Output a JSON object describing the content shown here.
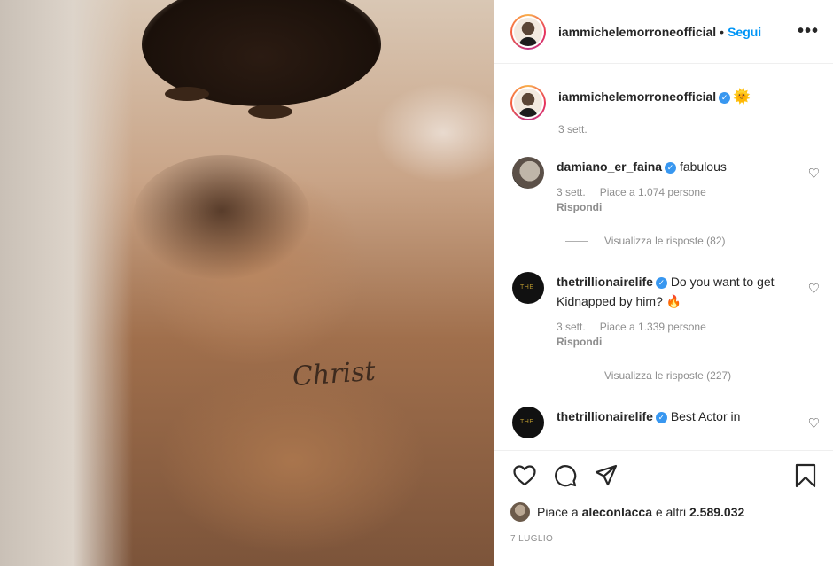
{
  "post_image": {
    "tattoo_text": "Christ",
    "alt": ""
  },
  "header": {
    "username": "iammichelemorroneofficial",
    "separator": "•",
    "follow_label": "Segui",
    "more_label": "•••"
  },
  "caption": {
    "username": "iammichelemorroneofficial",
    "emoji": "🌞",
    "time": "3 sett."
  },
  "comments": [
    {
      "username": "damiano_er_faina",
      "text": "fabulous",
      "time": "3 sett.",
      "likes": "Piace a 1.074 persone",
      "reply": "Rispondi",
      "view_replies": "Visualizza le risposte (82)"
    },
    {
      "username": "thetrillionairelife",
      "text": "Do you want to get Kidnapped by him? 🔥",
      "time": "3 sett.",
      "likes": "Piace a 1.339 persone",
      "reply": "Rispondi",
      "view_replies": "Visualizza le risposte (227)"
    },
    {
      "username": "thetrillionairelife",
      "text": "Best Actor in"
    }
  ],
  "likes_line": {
    "prefix": "Piace a ",
    "user": "aleconlacca",
    "suffix": " e altri ",
    "count": "2.589.032"
  },
  "date": "7 LUGLIO",
  "icons": [
    "heart-icon",
    "comment-icon",
    "share-icon",
    "bookmark-icon",
    "verified-icon",
    "more-icon"
  ],
  "colors": {
    "link": "#0095f6",
    "text": "#262626",
    "muted": "#8e8e8e",
    "verified": "#3897f0"
  }
}
